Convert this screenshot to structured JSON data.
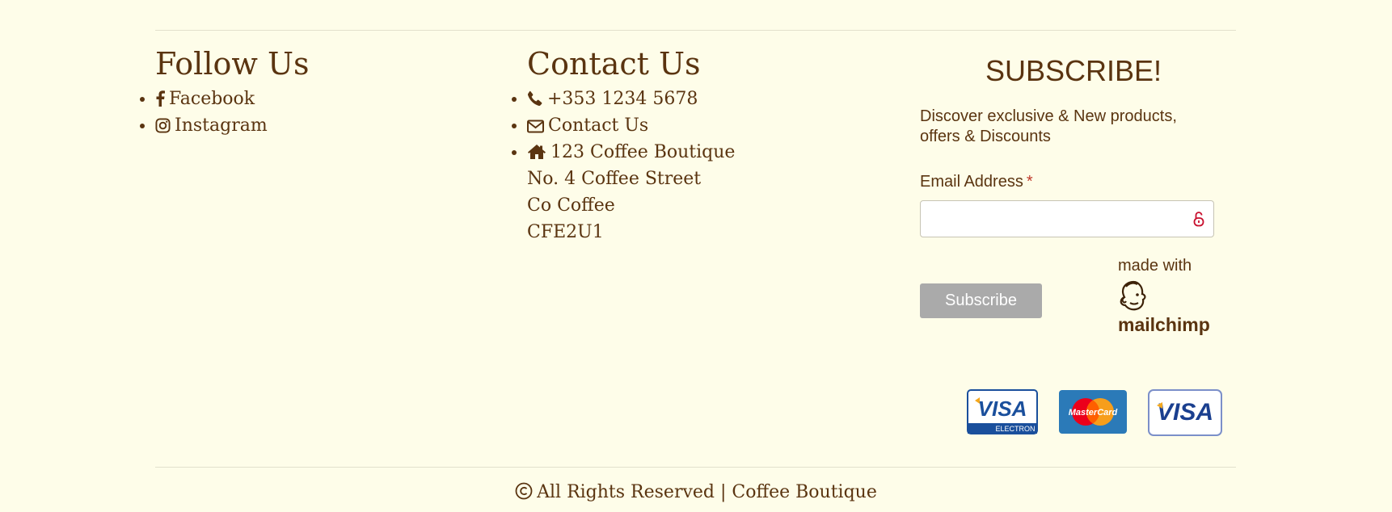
{
  "follow": {
    "title": "Follow Us",
    "items": [
      {
        "icon": "facebook-icon",
        "label": "Facebook"
      },
      {
        "icon": "instagram-icon",
        "label": "Instagram"
      }
    ]
  },
  "contact": {
    "title": "Contact Us",
    "phone": "+353 1234 5678",
    "email_link": "Contact Us",
    "address": [
      "123 Coffee Boutique",
      "No. 4 Coffee Street",
      "Co Coffee",
      "CFE2U1"
    ]
  },
  "subscribe": {
    "title": "SUBSCRIBE!",
    "description": "Discover exclusive & New products, offers & Discounts",
    "email_label": "Email Address",
    "required_mark": "*",
    "email_value": "",
    "button_label": "Subscribe",
    "made_with": "made with",
    "brand": "mailchimp"
  },
  "payment_cards": [
    "visa-electron-card",
    "mastercard-card",
    "visa-card"
  ],
  "footer": {
    "copyright": "All Rights Reserved | Coffee Boutique"
  },
  "colors": {
    "background": "#fefde9",
    "text": "#5a3410",
    "button": "#aaaaaa",
    "required": "#c0392b"
  }
}
